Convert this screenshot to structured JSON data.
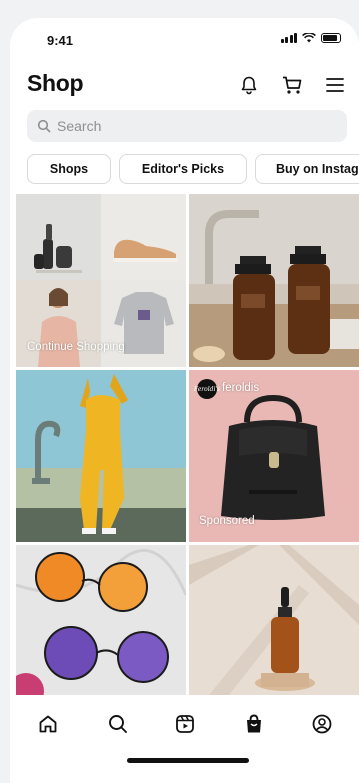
{
  "status_bar": {
    "time": "9:41"
  },
  "header": {
    "title": "Shop"
  },
  "search": {
    "placeholder": "Search"
  },
  "chips": [
    "Shops",
    "Editor's Picks",
    "Buy on Instag"
  ],
  "tiles": {
    "continue_shopping": "Continue Shopping",
    "sponsored_account": "feroldis",
    "sponsored_label": "Sponsored",
    "sponsored_logo": "Feroldi's"
  },
  "icons": {
    "notifications": "bell-icon",
    "cart": "cart-icon",
    "menu": "menu-icon",
    "search": "search-icon",
    "tabs": [
      "home-icon",
      "search-icon",
      "reels-icon",
      "shop-icon",
      "profile-icon"
    ]
  },
  "colors": {
    "background": "#ffffff",
    "search_bg": "#eeeff1",
    "text": "#111111"
  }
}
